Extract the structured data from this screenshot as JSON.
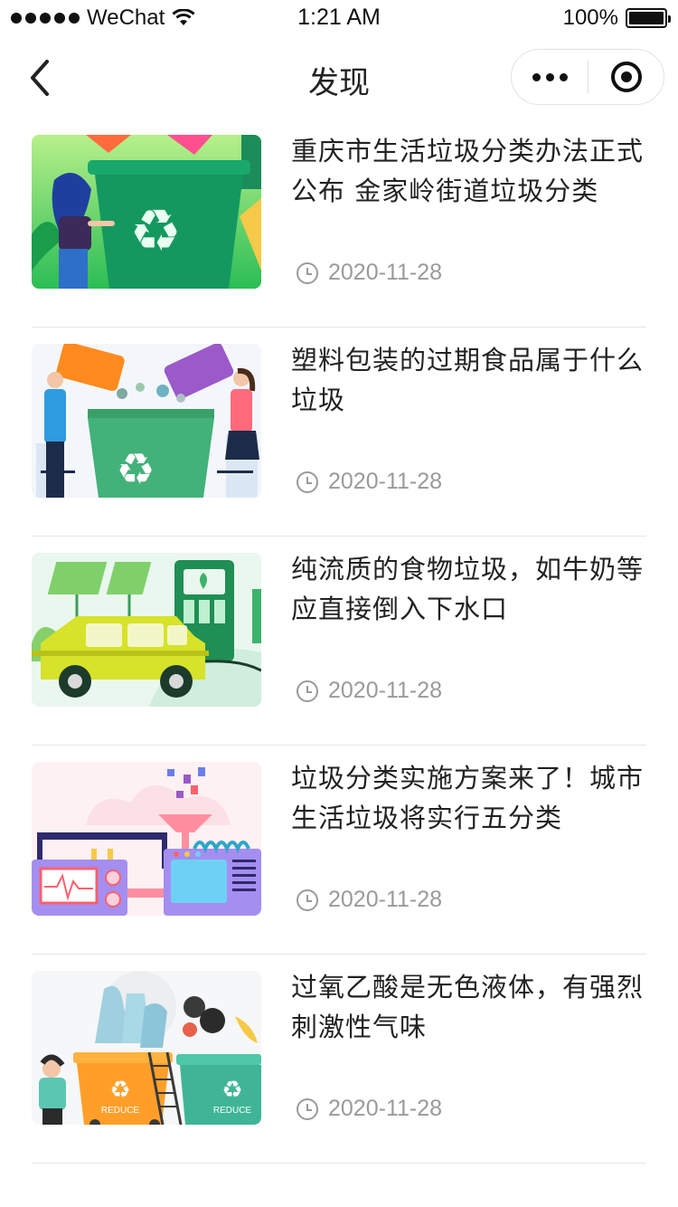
{
  "status_bar": {
    "carrier": "WeChat",
    "time": "1:21 AM",
    "battery": "100%"
  },
  "nav": {
    "title": "发现"
  },
  "articles": [
    {
      "title": "重庆市生活垃圾分类办法正式公布 金家岭街道垃圾分类",
      "date": "2020-11-28"
    },
    {
      "title": "塑料包装的过期食品属于什么垃圾",
      "date": "2020-11-28"
    },
    {
      "title": "纯流质的食物垃圾，如牛奶等应直接倒入下水口",
      "date": "2020-11-28"
    },
    {
      "title": "垃圾分类实施方案来了！城市生活垃圾将实行五分类",
      "date": "2020-11-28"
    },
    {
      "title": "过氧乙酸是无色液体，有强烈刺激性气味",
      "date": "2020-11-28"
    }
  ],
  "thumb_labels": {
    "reduce_left": "REDUCE",
    "reduce_right": "REDUCE"
  },
  "colors": {
    "text_primary": "#222222",
    "text_secondary": "#9a9a9a",
    "divider": "#e6e6e6"
  }
}
